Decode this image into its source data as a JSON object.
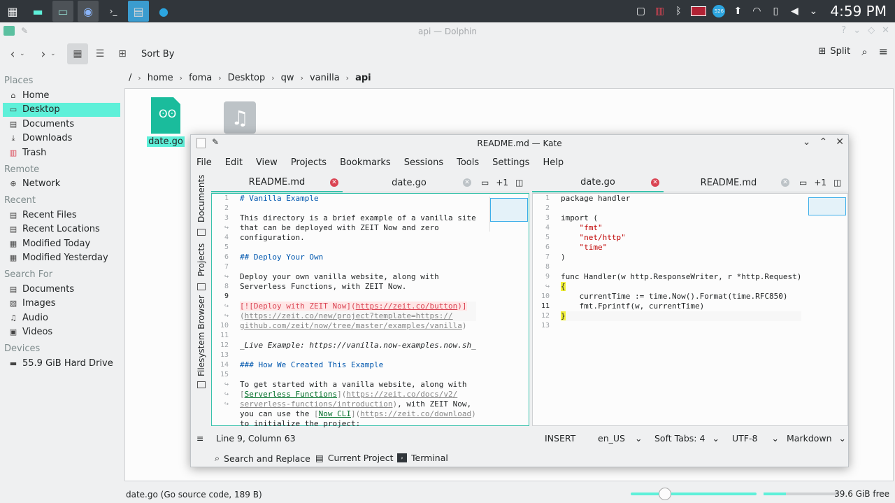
{
  "taskbar": {
    "clock": "4:59 PM",
    "badge": "526"
  },
  "dolphin": {
    "title": "api — Dolphin",
    "sort_by": "Sort By",
    "split": "Split",
    "places": [
      {
        "section": "Places",
        "items": [
          {
            "icon": "home-icon",
            "label": "Home",
            "selected": false
          },
          {
            "icon": "desktop-icon",
            "label": "Desktop",
            "selected": true
          },
          {
            "icon": "documents-icon",
            "label": "Documents",
            "selected": false
          },
          {
            "icon": "downloads-icon",
            "label": "Downloads",
            "selected": false
          },
          {
            "icon": "trash-icon",
            "label": "Trash",
            "selected": false
          }
        ]
      },
      {
        "section": "Remote",
        "items": [
          {
            "icon": "network-icon",
            "label": "Network",
            "selected": false
          }
        ]
      },
      {
        "section": "Recent",
        "items": [
          {
            "icon": "recent-files-icon",
            "label": "Recent Files",
            "selected": false
          },
          {
            "icon": "recent-locations-icon",
            "label": "Recent Locations",
            "selected": false
          },
          {
            "icon": "calendar-icon",
            "label": "Modified Today",
            "selected": false
          },
          {
            "icon": "calendar-icon",
            "label": "Modified Yesterday",
            "selected": false
          }
        ]
      },
      {
        "section": "Search For",
        "items": [
          {
            "icon": "documents-icon",
            "label": "Documents",
            "selected": false
          },
          {
            "icon": "images-icon",
            "label": "Images",
            "selected": false
          },
          {
            "icon": "audio-icon",
            "label": "Audio",
            "selected": false
          },
          {
            "icon": "videos-icon",
            "label": "Videos",
            "selected": false
          }
        ]
      },
      {
        "section": "Devices",
        "items": [
          {
            "icon": "hard-drive-icon",
            "label": "55.9 GiB Hard Drive",
            "selected": false
          }
        ]
      }
    ],
    "breadcrumb": [
      "/",
      "home",
      "foma",
      "Desktop",
      "qw",
      "vanilla",
      "api"
    ],
    "files": [
      {
        "name": "date.go",
        "selected": true
      }
    ],
    "status_text": "date.go (Go source code, 189 B)",
    "free_space": "39.6 GiB free"
  },
  "kate": {
    "title": "README.md — Kate",
    "menu": [
      "File",
      "Edit",
      "View",
      "Projects",
      "Bookmarks",
      "Sessions",
      "Tools",
      "Settings",
      "Help"
    ],
    "side_tabs": [
      "Documents",
      "Projects",
      "Filesystem Browser"
    ],
    "left_tabs": [
      {
        "label": "README.md",
        "active": true
      },
      {
        "label": "date.go",
        "active": false
      }
    ],
    "right_tabs": [
      {
        "label": "date.go",
        "active": true
      },
      {
        "label": "README.md",
        "active": false
      }
    ],
    "tab_extra": "+1",
    "left_gutter": [
      "1",
      "2",
      "3",
      "↪",
      "4",
      "5",
      "6",
      "7",
      "↪",
      "8",
      "9",
      "↪",
      "↪",
      "10",
      "11",
      "12",
      "13",
      "14",
      "15",
      "↪",
      "↪",
      "↪"
    ],
    "right_gutter": [
      "1",
      "2",
      "3",
      "4",
      "5",
      "6",
      "7",
      "8",
      "9",
      "↪",
      "10",
      "11",
      "12",
      "13"
    ],
    "status": {
      "position": "Line 9, Column 63",
      "mode": "INSERT",
      "language": "en_US",
      "indent": "Soft Tabs: 4",
      "encoding": "UTF-8",
      "syntax": "Markdown"
    },
    "bottom": {
      "search": "Search and Replace",
      "project": "Current Project",
      "terminal": "Terminal"
    }
  }
}
